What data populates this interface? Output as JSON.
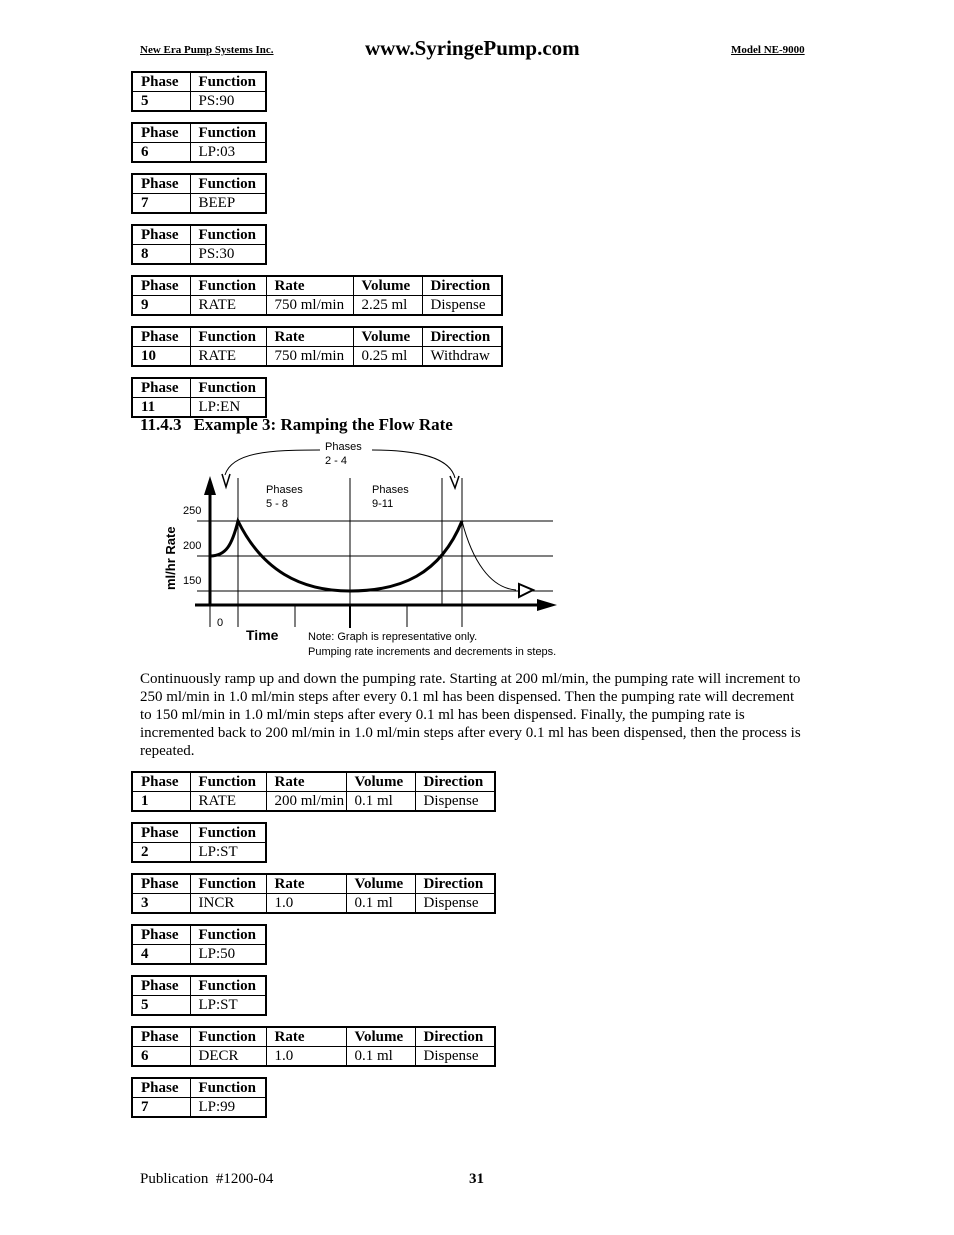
{
  "header": {
    "company": "New Era Pump Systems Inc.",
    "url": "www.SyringePump.com",
    "model": "Model NE-9000"
  },
  "columns": {
    "phase": "Phase",
    "function": "Function",
    "rate": "Rate",
    "volume": "Volume",
    "direction": "Direction"
  },
  "tables_top": [
    {
      "phase": "5",
      "function": "PS:90"
    },
    {
      "phase": "6",
      "function": "LP:03"
    },
    {
      "phase": "7",
      "function": "BEEP"
    },
    {
      "phase": "8",
      "function": "PS:30"
    },
    {
      "phase": "9",
      "function": "RATE",
      "rate": "750 ml/min",
      "volume": "2.25 ml",
      "direction": "Dispense"
    },
    {
      "phase": "10",
      "function": "RATE",
      "rate": "750 ml/min",
      "volume": "0.25 ml",
      "direction": "Withdraw"
    },
    {
      "phase": "11",
      "function": "LP:EN"
    }
  ],
  "section": {
    "number": "11.4.3",
    "title": "Example 3:  Ramping the Flow Rate"
  },
  "diagram": {
    "loop_label_1": "Phases",
    "loop_label_2": "2 - 4",
    "region1_label_1": "Phases",
    "region1_label_2": "5 - 8",
    "region2_label_1": "Phases",
    "region2_label_2": "9-11",
    "y_label": "ml/hr Rate",
    "y_ticks": [
      "250",
      "200",
      "150"
    ],
    "x_origin": "0",
    "x_label": "Time",
    "note_1": "Note:  Graph is representative only.",
    "note_2": "Pumping rate increments and decrements in steps."
  },
  "paragraph": "Continuously ramp up and down the pumping rate.  Starting at 200 ml/min, the pumping rate will increment to 250 ml/min in 1.0 ml/min steps after every 0.1 ml has been dispensed.  Then the pumping rate will decrement to 150 ml/min in 1.0 ml/min steps after every 0.1 ml has been dispensed.  Finally, the pumping rate is incremented back to 200 ml/min in 1.0 ml/min steps after every 0.1 ml has been dispensed, then the process is repeated.",
  "tables_bottom": [
    {
      "phase": "1",
      "function": "RATE",
      "rate": "200 ml/min",
      "volume": "0.1 ml",
      "direction": "Dispense"
    },
    {
      "phase": "2",
      "function": "LP:ST"
    },
    {
      "phase": "3",
      "function": "INCR",
      "rate": "1.0",
      "volume": "0.1 ml",
      "direction": "Dispense"
    },
    {
      "phase": "4",
      "function": "LP:50"
    },
    {
      "phase": "5",
      "function": "LP:ST"
    },
    {
      "phase": "6",
      "function": "DECR",
      "rate": "1.0",
      "volume": "0.1 ml",
      "direction": "Dispense"
    },
    {
      "phase": "7",
      "function": "LP:99"
    }
  ],
  "footer": {
    "publication": "Publication  #1200-04",
    "page": "31"
  }
}
